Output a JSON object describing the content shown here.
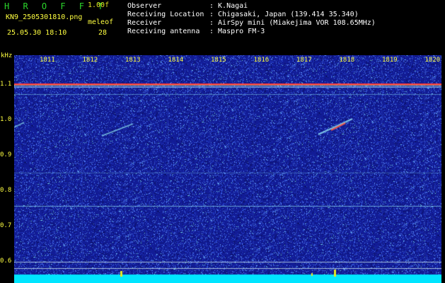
{
  "header": {
    "app_title": "H R O F F T",
    "version": "1.00f",
    "filename": "KN9_2505301810.png",
    "software": "meleof",
    "datetime": "25.05.30 18:10",
    "count": "28"
  },
  "info": [
    {
      "label": "Observer",
      "value": ": K.Nagai"
    },
    {
      "label": "Receiving Location",
      "value": ": Chigasaki, Japan (139.414 35.340)"
    },
    {
      "label": "Receiver",
      "value": ": AirSpy mini (Miakejima VOR 108.65MHz)"
    },
    {
      "label": "Receiving antenna",
      "value": ": Maspro FM-3"
    }
  ],
  "axes": {
    "y_unit": "kHz",
    "y_ticks": [
      "1.1",
      "1.0",
      "0.9",
      "0.8",
      "0.7",
      "0.6"
    ],
    "x_ticks": [
      "1811",
      "1812",
      "1813",
      "1814",
      "1815",
      "1816",
      "1817",
      "1818",
      "1819",
      "1820"
    ]
  },
  "colors": {
    "background": "#000000",
    "spectrogram_base": "#1a2a9a",
    "carrier_line": "#ff3030",
    "noise_floor": "#00e5ff",
    "header_text": "#ffff40",
    "title_text": "#2bd62b"
  }
}
